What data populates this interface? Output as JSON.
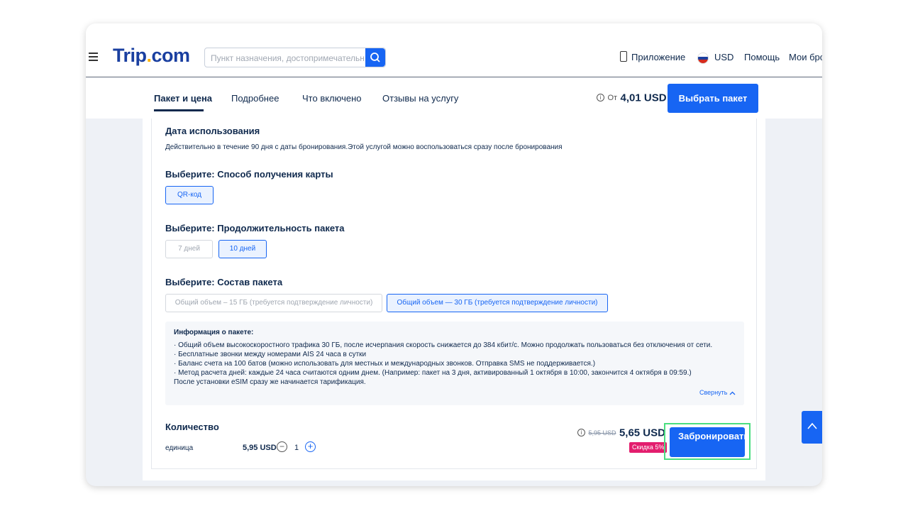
{
  "header": {
    "logo_main": "Trip",
    "logo_dot": ".",
    "logo_suffix": "com",
    "search_placeholder": "Пункт назначения, достопримечательн...",
    "app_label": "Приложение",
    "currency": "USD",
    "help": "Помощь",
    "bookings": "Мои бро"
  },
  "subnav": {
    "tabs": [
      {
        "label": "Пакет и цена"
      },
      {
        "label": "Подробнее"
      },
      {
        "label": "Что включено"
      },
      {
        "label": "Отзывы на услугу"
      }
    ],
    "from_label": "От",
    "from_price": "4,01 USD",
    "select_button": "Выбрать пакет"
  },
  "usage": {
    "title": "Дата использования",
    "desc": "Действительно в течение 90 дня с даты бронирования.Этой услугой можно воспользоваться сразу после бронирования"
  },
  "card_method": {
    "title": "Выберите: Способ получения карты",
    "options": [
      "QR-код"
    ]
  },
  "duration": {
    "title": "Выберите: Продолжительность пакета",
    "options": [
      "7 дней",
      "10 дней"
    ]
  },
  "package": {
    "title": "Выберите: Состав пакета",
    "options": [
      "Общий объем – 15 ГБ (требуется подтверждение личности)",
      "Общий объем — 30 ГБ (требуется подтверждение личности)"
    ]
  },
  "info": {
    "title": "Информация о пакете:",
    "lines": [
      "· Общий объем высокоскоростного трафика 30 ГБ, после исчерпания скорость снижается до 384 кбит/с. Можно продолжать пользоваться без отключения от сети.",
      "· Бесплатные звонки между номерами AIS 24 часа в сутки",
      "· Баланс счета на 100 батов (можно использовать для местных и международных звонков. Отправка SMS не поддерживается.)",
      "· Метод расчета дней: каждые 24 часа считаются одним днем. (Например: пакет на 3 дня, активированный 1 октября в 10:00, закончится 4 октября в 09:59.)",
      "После установки eSIM сразу же начинается тарификация."
    ],
    "collapse": "Свернуть"
  },
  "quantity": {
    "title": "Количество",
    "unit_label": "единица",
    "unit_price": "5,95 USD",
    "value": "1",
    "old_price": "5,95 USD",
    "new_price": "5,65 USD",
    "discount": "Скидка 5%",
    "book_button": "Забронировать"
  },
  "colors": {
    "accent": "#1765f3",
    "discount": "#e31e6e",
    "highlight": "#4ade80"
  }
}
